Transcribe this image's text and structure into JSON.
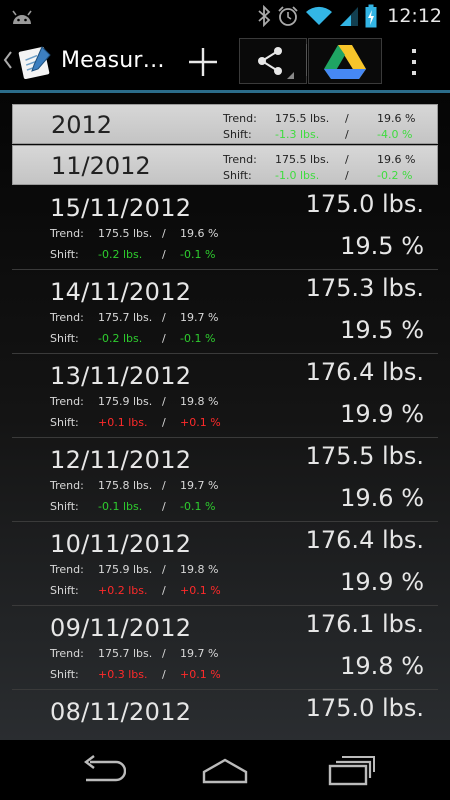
{
  "status_bar": {
    "time": "12:12",
    "icons": [
      "android-icon",
      "bluetooth-icon",
      "alarm-icon",
      "wifi-icon",
      "signal-icon",
      "battery-charging-icon"
    ]
  },
  "action_bar": {
    "title": "Measur…",
    "icons": [
      "up-caret-icon",
      "app-logo-icon",
      "add-icon",
      "share-icon",
      "google-drive-icon",
      "overflow-menu-icon"
    ],
    "accent_color": "#2b6c8a"
  },
  "groups": [
    {
      "title": "2012",
      "trend_label": "Trend:",
      "trend_weight": "175.5 lbs.",
      "trend_fat": "19.6 %",
      "shift_label": "Shift:",
      "shift_weight": "-1.3 lbs.",
      "shift_fat": "-4.0 %",
      "slash": "/"
    },
    {
      "title": "11/2012",
      "trend_label": "Trend:",
      "trend_weight": "175.5 lbs.",
      "trend_fat": "19.6 %",
      "shift_label": "Shift:",
      "shift_weight": "-1.0 lbs.",
      "shift_fat": "-0.2 %",
      "slash": "/"
    }
  ],
  "entries": [
    {
      "date": "15/11/2012",
      "weight": "175.0 lbs.",
      "fat": "19.5 %",
      "trend_label": "Trend:",
      "trend_weight": "175.5 lbs.",
      "trend_fat": "19.6 %",
      "shift_label": "Shift:",
      "shift_weight": "-0.2 lbs.",
      "shift_fat": "-0.1 %",
      "shift_color": "green",
      "slash": "/"
    },
    {
      "date": "14/11/2012",
      "weight": "175.3 lbs.",
      "fat": "19.5 %",
      "trend_label": "Trend:",
      "trend_weight": "175.7 lbs.",
      "trend_fat": "19.7 %",
      "shift_label": "Shift:",
      "shift_weight": "-0.2 lbs.",
      "shift_fat": "-0.1 %",
      "shift_color": "green",
      "slash": "/"
    },
    {
      "date": "13/11/2012",
      "weight": "176.4 lbs.",
      "fat": "19.9 %",
      "trend_label": "Trend:",
      "trend_weight": "175.9 lbs.",
      "trend_fat": "19.8 %",
      "shift_label": "Shift:",
      "shift_weight": "+0.1 lbs.",
      "shift_fat": "+0.1 %",
      "shift_color": "red",
      "slash": "/"
    },
    {
      "date": "12/11/2012",
      "weight": "175.5 lbs.",
      "fat": "19.6 %",
      "trend_label": "Trend:",
      "trend_weight": "175.8 lbs.",
      "trend_fat": "19.7 %",
      "shift_label": "Shift:",
      "shift_weight": "-0.1 lbs.",
      "shift_fat": "-0.1 %",
      "shift_color": "green",
      "slash": "/"
    },
    {
      "date": "10/11/2012",
      "weight": "176.4 lbs.",
      "fat": "19.9 %",
      "trend_label": "Trend:",
      "trend_weight": "175.9 lbs.",
      "trend_fat": "19.8 %",
      "shift_label": "Shift:",
      "shift_weight": "+0.2 lbs.",
      "shift_fat": "+0.1 %",
      "shift_color": "red",
      "slash": "/"
    },
    {
      "date": "09/11/2012",
      "weight": "176.1 lbs.",
      "fat": "19.8 %",
      "trend_label": "Trend:",
      "trend_weight": "175.7 lbs.",
      "trend_fat": "19.7 %",
      "shift_label": "Shift:",
      "shift_weight": "+0.3 lbs.",
      "shift_fat": "+0.1 %",
      "shift_color": "red",
      "slash": "/"
    },
    {
      "date": "08/11/2012",
      "weight": "175.0 lbs.",
      "fat": "",
      "trend_label": "",
      "trend_weight": "",
      "trend_fat": "",
      "shift_label": "",
      "shift_weight": "",
      "shift_fat": "",
      "shift_color": "green",
      "slash": ""
    }
  ],
  "colors": {
    "positive_shift": "#ff2a2a",
    "negative_shift": "#2ecc2e",
    "group_background": "#cfcfcf"
  },
  "nav_bar": {
    "icons": [
      "back-icon",
      "home-icon",
      "recent-apps-icon"
    ]
  }
}
